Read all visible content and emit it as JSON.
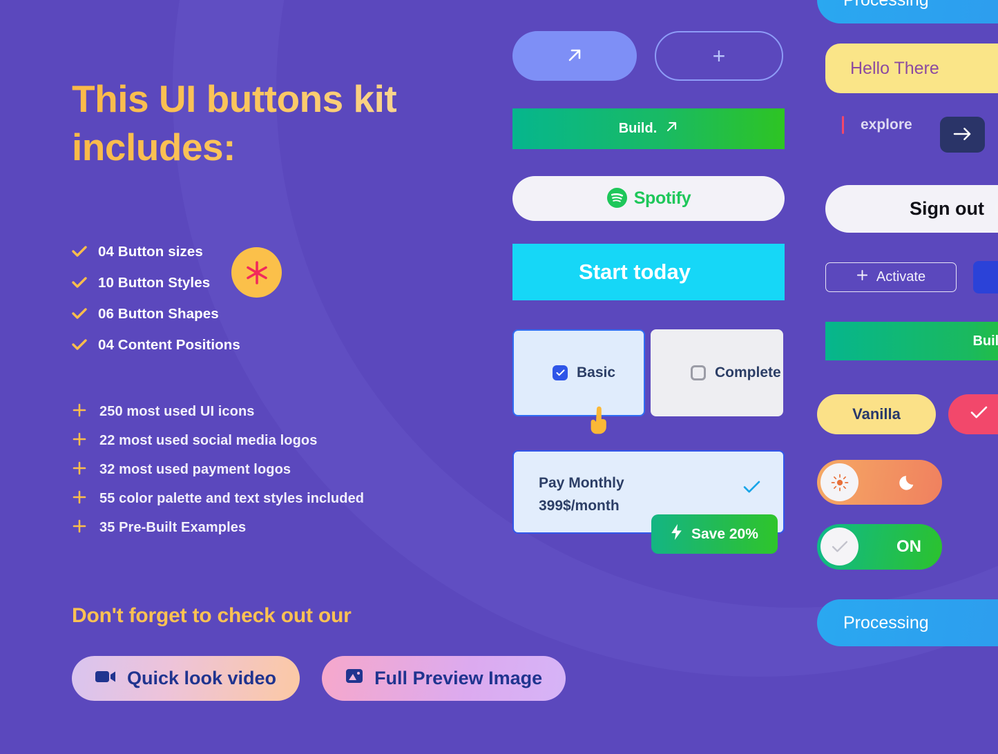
{
  "theme": {
    "background": "#5b48bd",
    "accent_yellow": "#fbbd4c",
    "accent_green": "#2ec423",
    "accent_cyan": "#16d7f7",
    "accent_blue": "#2b42d8",
    "accent_pink": "#f2486b"
  },
  "left": {
    "headline": "This UI buttons kit includes:",
    "check_items": [
      {
        "icon": "check-icon",
        "label": "04 Button sizes"
      },
      {
        "icon": "check-icon",
        "label": "10 Button Styles"
      },
      {
        "icon": "check-icon",
        "label": "06 Button Shapes"
      },
      {
        "icon": "check-icon",
        "label": "04 Content Positions"
      }
    ],
    "plus_items": [
      {
        "icon": "plus-icon",
        "label": "250 most used UI icons"
      },
      {
        "icon": "plus-icon",
        "label": "22 most used social media logos"
      },
      {
        "icon": "plus-icon",
        "label": "32 most used payment logos"
      },
      {
        "icon": "plus-icon",
        "label": "55 color palette and text styles included"
      },
      {
        "icon": "plus-icon",
        "label": "35 Pre-Built Examples"
      }
    ],
    "subhead": "Don't forget to check out our",
    "cta_video": "Quick look video",
    "cta_image": "Full Preview Image"
  },
  "center": {
    "pill_arrow_icon": "arrow-up-right-icon",
    "pill_plus_icon": "plus-icon",
    "pill_plus_glyph": "+",
    "build_label": "Build.",
    "spotify_label": "Spotify",
    "start_label": "Start today",
    "asterisk_glyph": "✳",
    "choice_basic": "Basic",
    "choice_complete": "Complete",
    "pay_title": "Pay Monthly",
    "pay_price": "399$/month",
    "save_label": "Save 20%"
  },
  "right": {
    "processing_top": "Processing",
    "hello": "Hello There",
    "explore": "explore",
    "signout": "Sign out",
    "activate": "Activate",
    "close_glyph": "✕",
    "build_label": "Build.",
    "vanilla": "Vanilla",
    "on_label": "ON",
    "processing_bottom": "Processing"
  }
}
